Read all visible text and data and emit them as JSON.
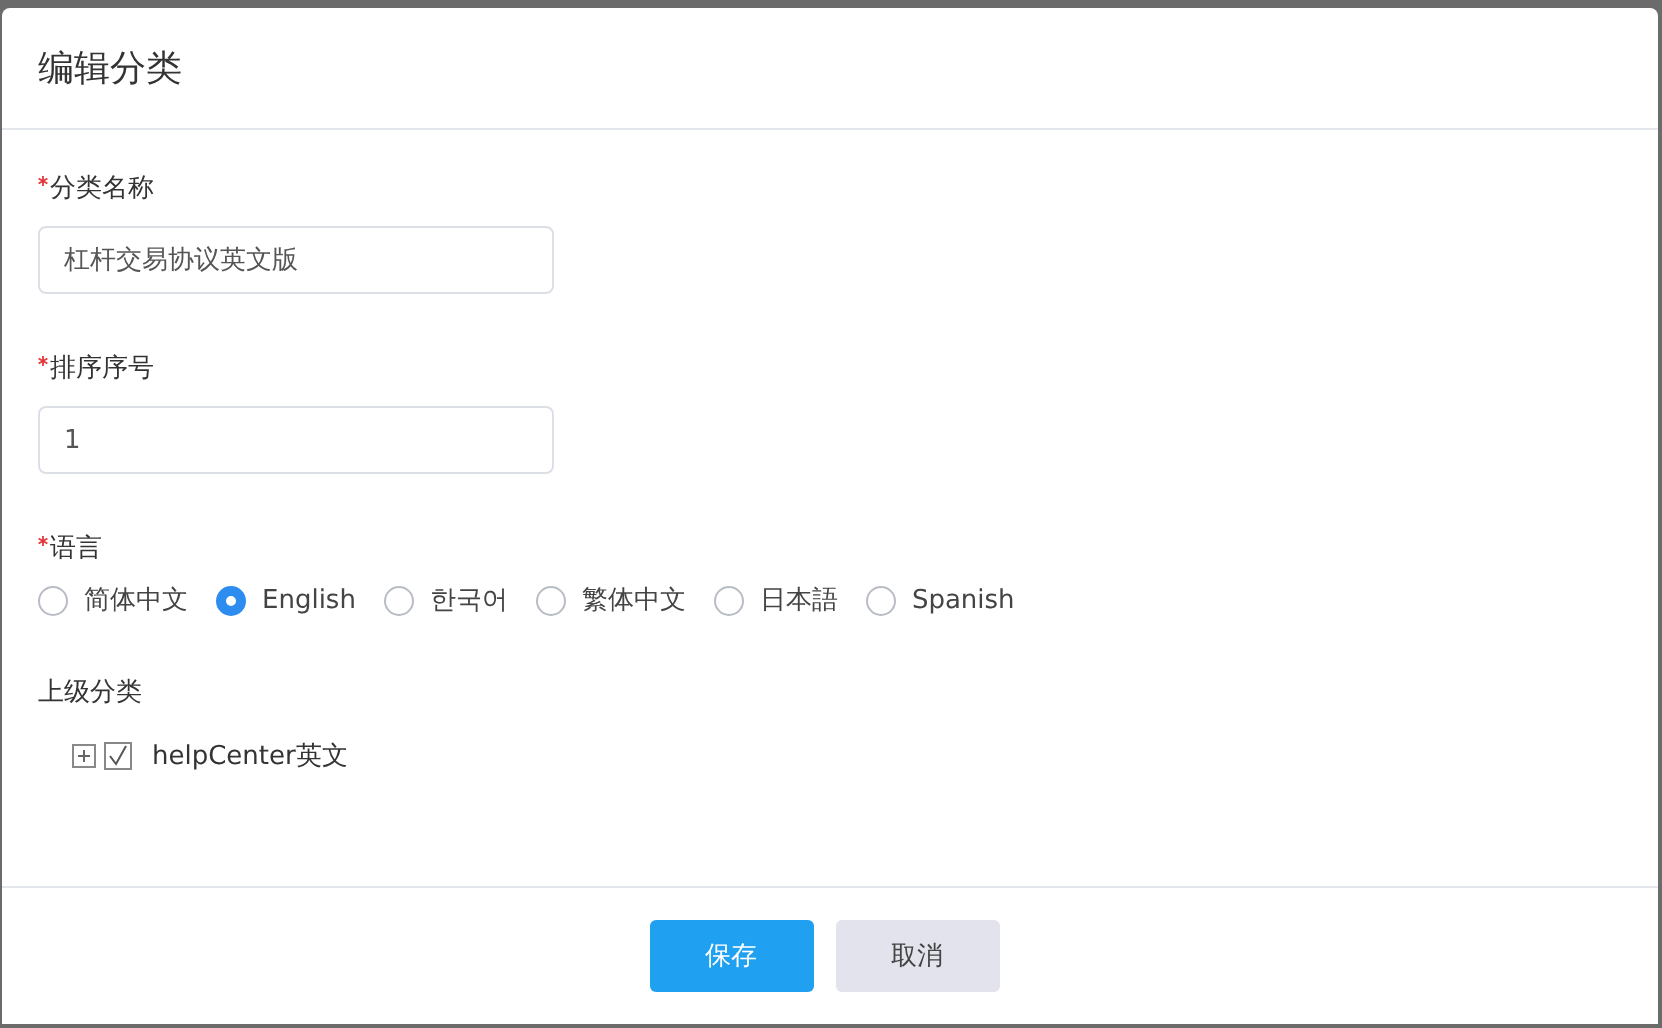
{
  "dialog": {
    "title": "编辑分类"
  },
  "fields": [
    {
      "label": "分类名称",
      "required": true,
      "value": "杠杆交易协议英文版"
    },
    {
      "label": "排序序号",
      "required": true,
      "value": "1"
    }
  ],
  "language": {
    "label": "语言",
    "required": true,
    "options": [
      {
        "label": "简体中文",
        "selected": false
      },
      {
        "label": "English",
        "selected": true
      },
      {
        "label": "한국어",
        "selected": false
      },
      {
        "label": "繁体中文",
        "selected": false
      },
      {
        "label": "日本語",
        "selected": false
      },
      {
        "label": "Spanish",
        "selected": false
      }
    ]
  },
  "parent": {
    "label": "上级分类",
    "tree": [
      {
        "label": "helpCenter英文",
        "expanded": false,
        "checked": true
      }
    ]
  },
  "buttons": [
    {
      "label": "保存",
      "kind": "primary"
    },
    {
      "label": "取消",
      "kind": "secondary"
    }
  ]
}
